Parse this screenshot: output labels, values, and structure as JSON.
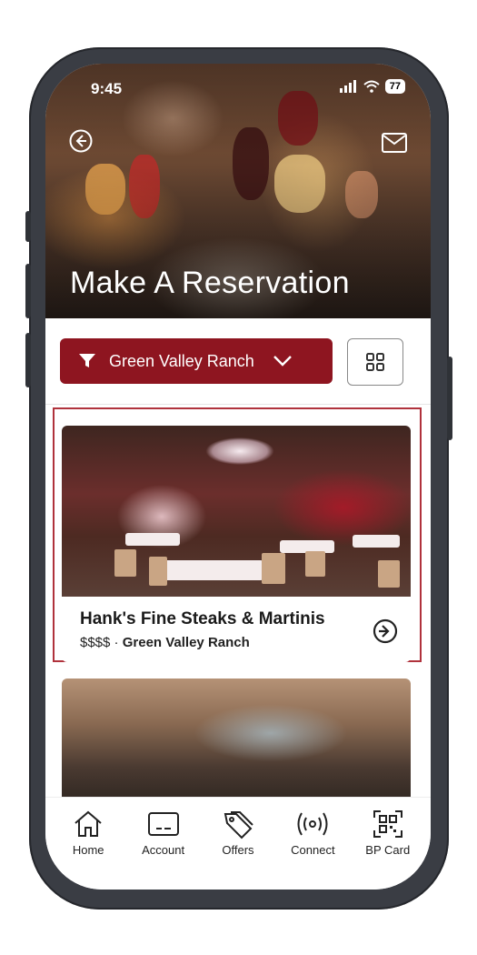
{
  "status": {
    "time": "9:45",
    "battery": "77"
  },
  "hero": {
    "title": "Make A Reservation"
  },
  "filter": {
    "selected": "Green Valley Ranch"
  },
  "restaurants": [
    {
      "name": "Hank's Fine Steaks & Martinis",
      "price": "$$$$",
      "separator": " · ",
      "location": "Green Valley Ranch"
    }
  ],
  "tabs": [
    {
      "label": "Home",
      "icon": "home-icon"
    },
    {
      "label": "Account",
      "icon": "card-icon"
    },
    {
      "label": "Offers",
      "icon": "tag-icon"
    },
    {
      "label": "Connect",
      "icon": "broadcast-icon"
    },
    {
      "label": "BP Card",
      "icon": "qr-icon"
    }
  ],
  "colors": {
    "brand": "#8e1520",
    "highlight": "#b0323c"
  }
}
